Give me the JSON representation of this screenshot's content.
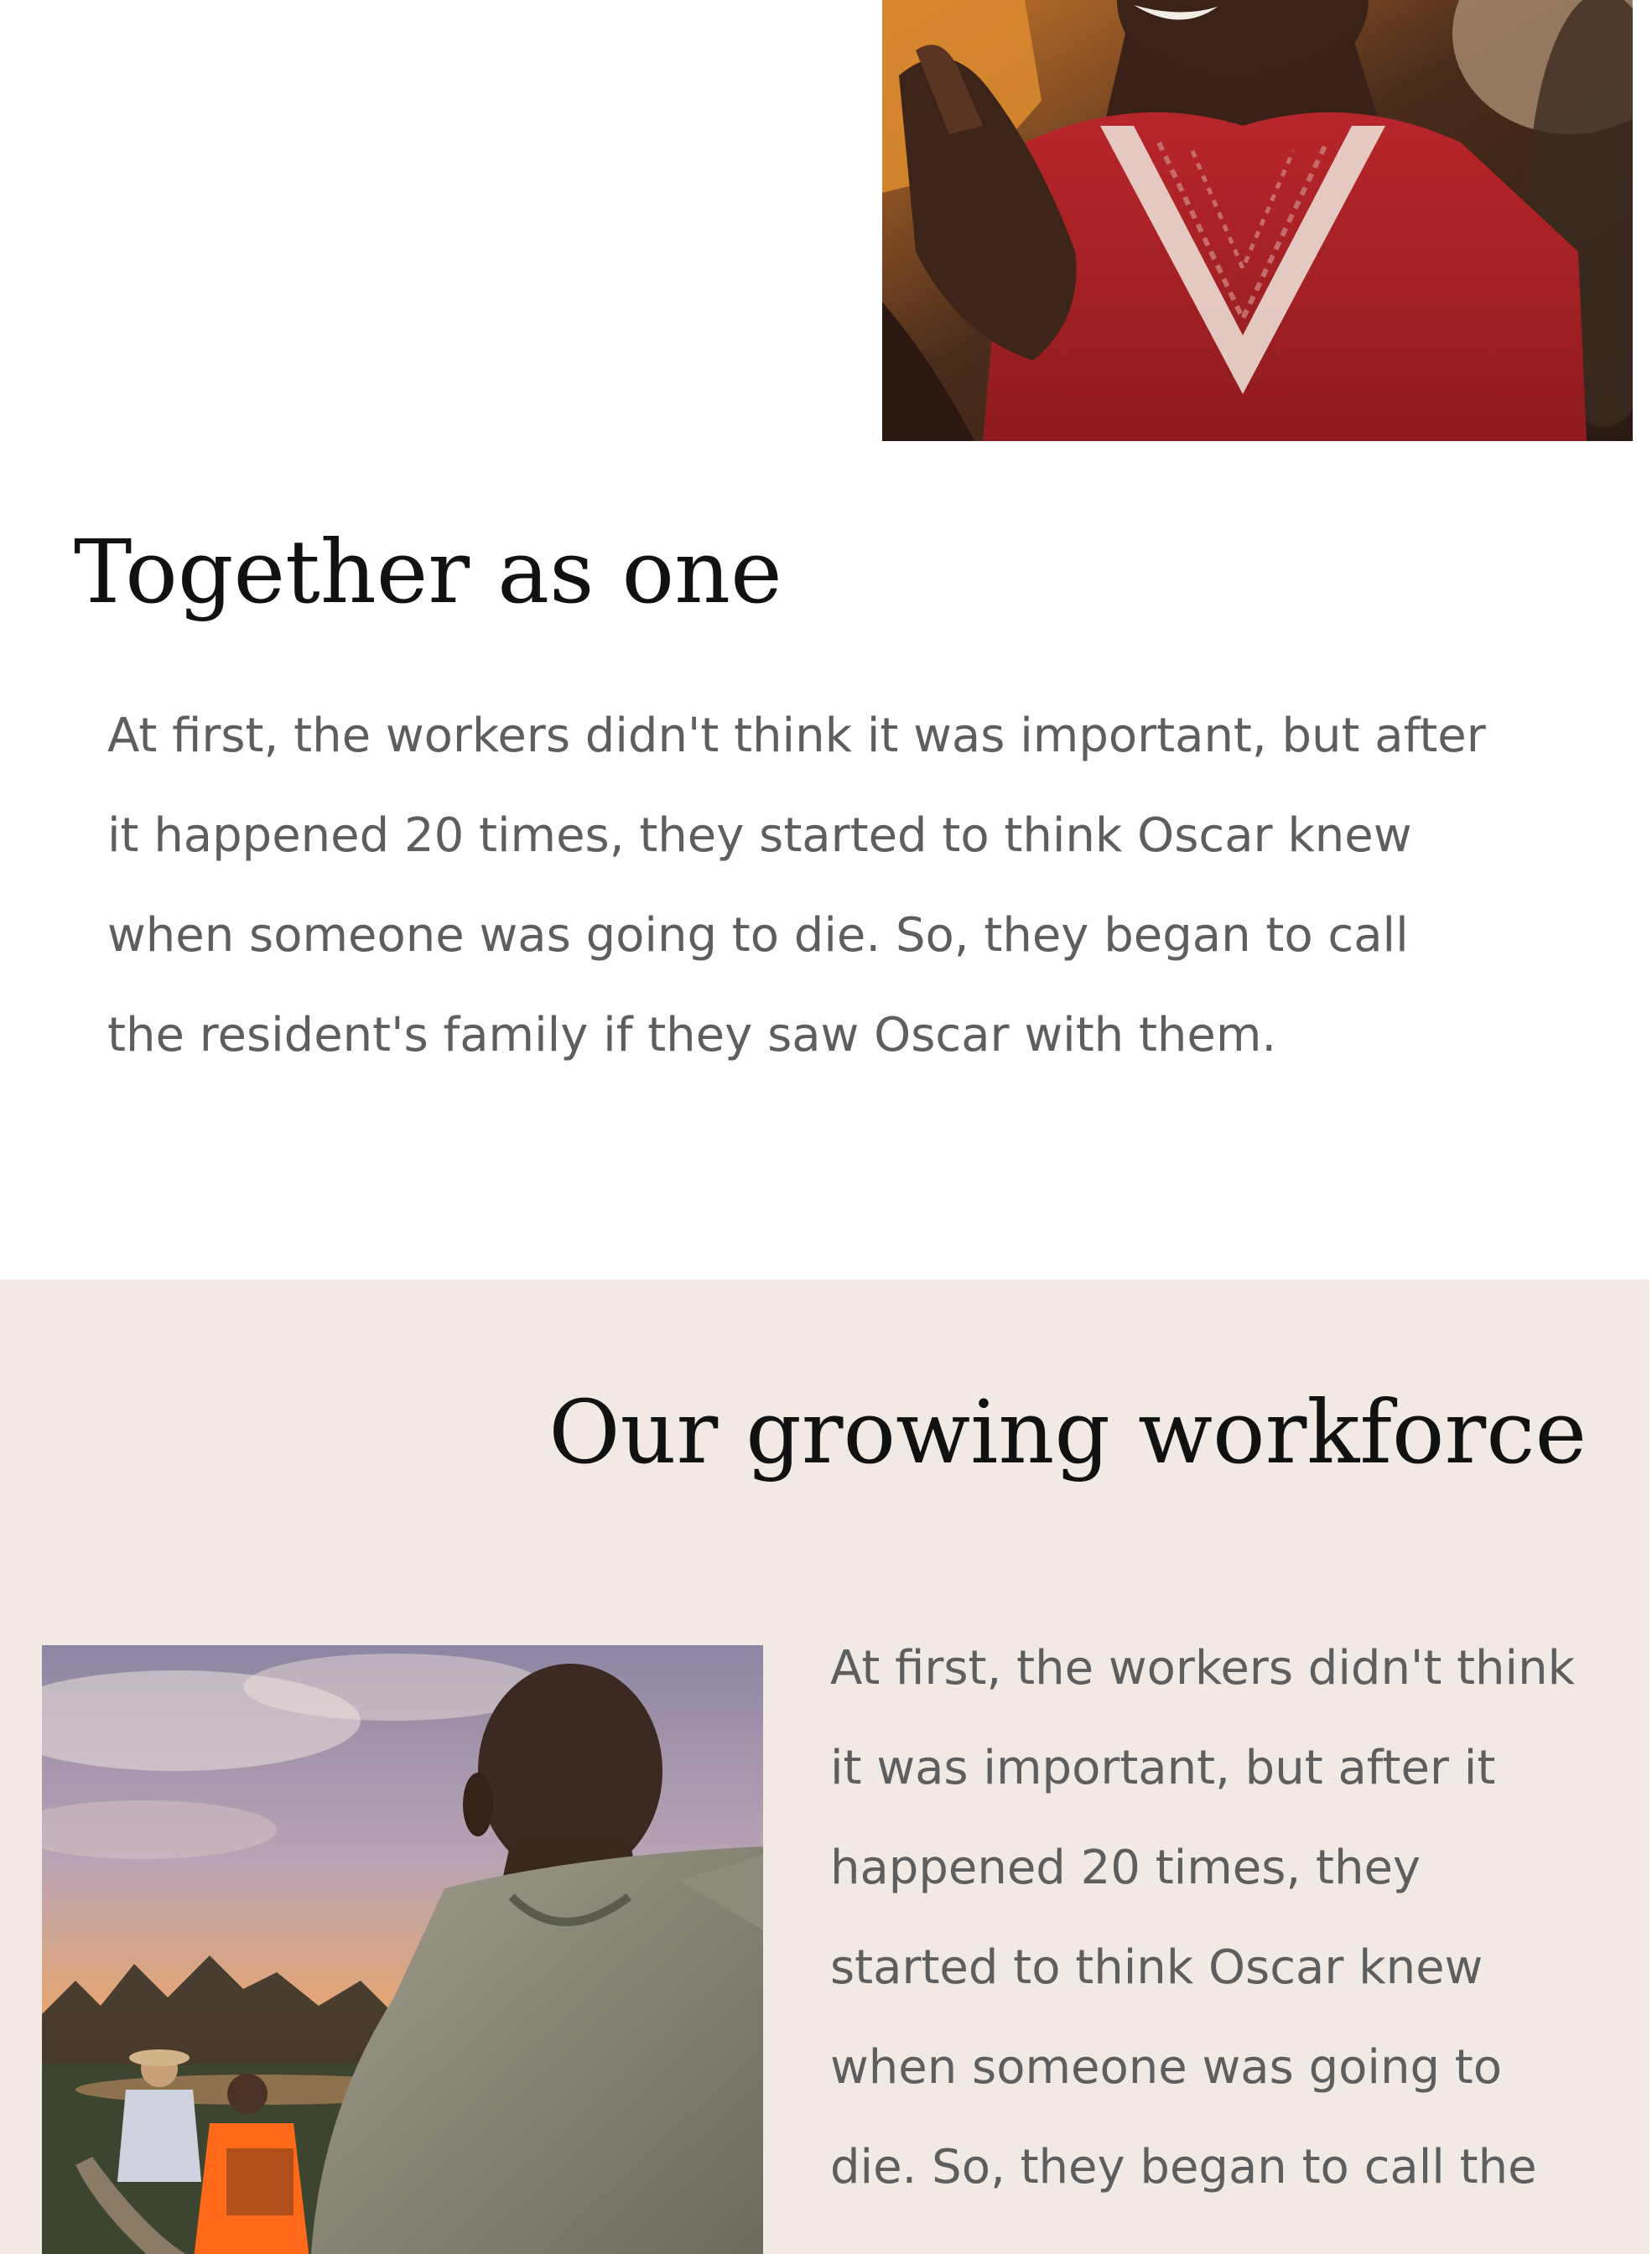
{
  "section_together": {
    "title": "Together as one",
    "paragraph_lines": [
      "At first, the workers didn't think it was important, but after",
      "it happened 20 times, they started to think Oscar knew",
      "when someone was going to die. So, they began to call",
      "the resident's family if they saw Oscar with them."
    ]
  },
  "section_workforce": {
    "title": "Our growing workforce",
    "paragraph_lines": [
      "At first, the workers didn't think",
      "it was important, but after it",
      "happened 20 times, they",
      "started to think Oscar knew",
      "when someone was going to",
      "die. So, they began to call the"
    ]
  },
  "colors": {
    "page_background": "#ffffff",
    "section_background": "#f0e9e4",
    "heading_text": "#111111",
    "body_text": "#5e5e5e"
  }
}
